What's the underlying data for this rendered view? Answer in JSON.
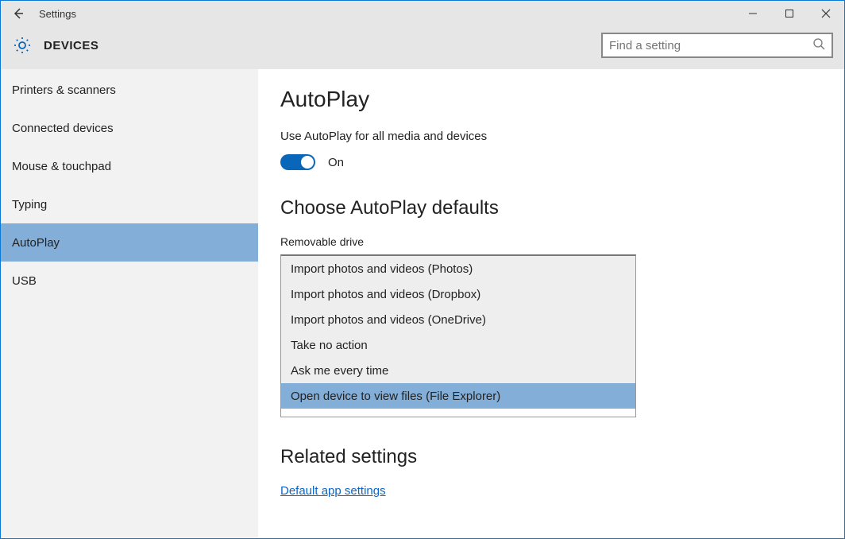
{
  "titlebar": {
    "title": "Settings"
  },
  "header": {
    "section": "DEVICES",
    "search_placeholder": "Find a setting"
  },
  "sidebar": {
    "items": [
      {
        "label": "Printers & scanners"
      },
      {
        "label": "Connected devices"
      },
      {
        "label": "Mouse & touchpad"
      },
      {
        "label": "Typing"
      },
      {
        "label": "AutoPlay"
      },
      {
        "label": "USB"
      }
    ],
    "selected_index": 4
  },
  "main": {
    "title": "AutoPlay",
    "autoplay_text": "Use AutoPlay for all media and devices",
    "toggle_state": "On",
    "defaults_heading": "Choose AutoPlay defaults",
    "removable_label": "Removable drive",
    "dropdown": {
      "options": [
        "Import photos and videos (Photos)",
        "Import photos and videos (Dropbox)",
        "Import photos and videos (OneDrive)",
        "Take no action",
        "Ask me every time",
        "Open device to view files (File Explorer)"
      ],
      "highlighted_index": 5
    },
    "related_heading": "Related settings",
    "related_link": "Default app settings"
  },
  "colors": {
    "accent": "#0a66b8",
    "selection": "#83aed8"
  }
}
